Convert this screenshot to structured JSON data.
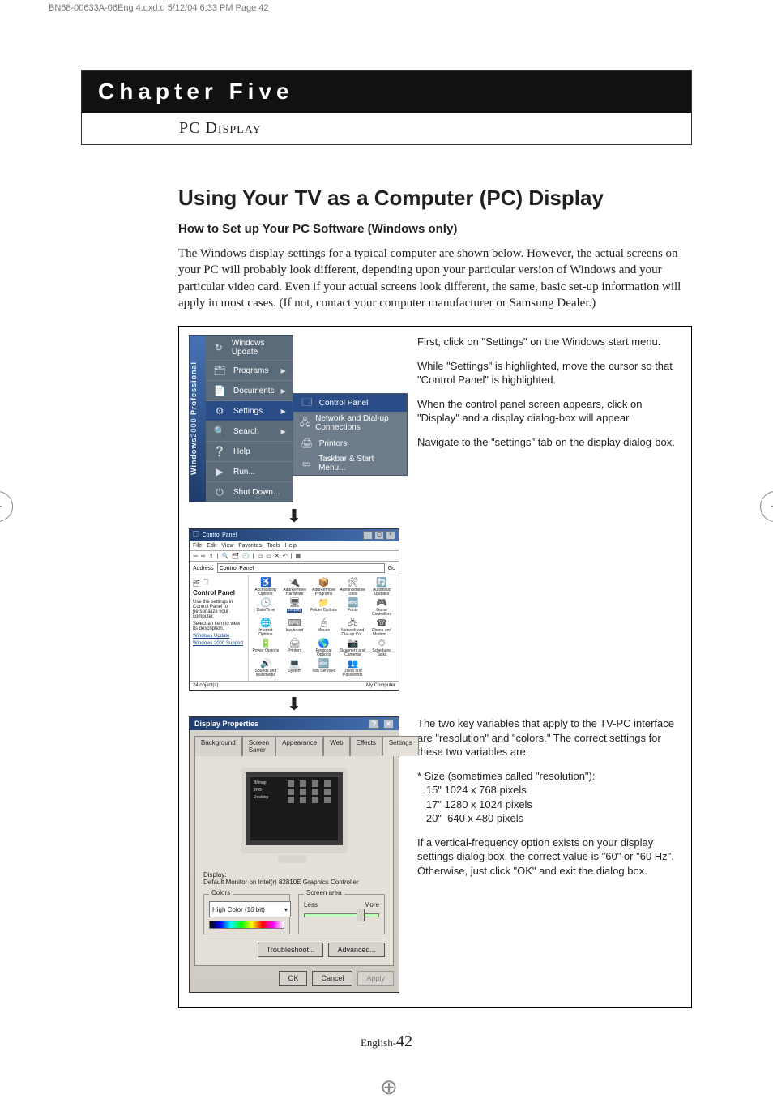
{
  "crop_header": "BN68-00633A-06Eng 4.qxd.q  5/12/04 6:33 PM  Page 42",
  "chapter": {
    "title": "Chapter Five",
    "subtitle": "PC Display"
  },
  "section": {
    "h1": "Using Your TV as a Computer (PC) Display",
    "h2": "How to Set up Your PC Software (Windows only)",
    "body": "The Windows display-settings for a typical computer are shown below. However, the actual screens on your PC will probably look different, depending upon your particular version of Windows and your particular video card. Even if your actual screens look different, the same, basic set-up information will apply in most cases. (If not, contact your computer manufacturer or Samsung Dealer.)"
  },
  "startmenu": {
    "side_label_a": "Windows",
    "side_label_b": "2000",
    "side_label_c": "Professional",
    "items": [
      {
        "label": "Windows Update",
        "icon": "↻"
      },
      {
        "label": "Programs",
        "icon": "🗂",
        "arrow": true
      },
      {
        "label": "Documents",
        "icon": "📄",
        "arrow": true
      },
      {
        "label": "Settings",
        "icon": "⚙",
        "arrow": true,
        "selected": true
      },
      {
        "label": "Search",
        "icon": "🔍",
        "arrow": true
      },
      {
        "label": "Help",
        "icon": "❔"
      },
      {
        "label": "Run...",
        "icon": "▶"
      },
      {
        "label": "Shut Down...",
        "icon": "⏻"
      }
    ],
    "submenu": [
      {
        "label": "Control Panel",
        "icon": "🗔",
        "selected": true
      },
      {
        "label": "Network and Dial-up Connections",
        "icon": "🖧"
      },
      {
        "label": "Printers",
        "icon": "🖨"
      },
      {
        "label": "Taskbar & Start Menu...",
        "icon": "▭"
      }
    ]
  },
  "instructions_top": {
    "p1": "First, click on \"Settings\" on the Windows start menu.",
    "p2": "While \"Settings\" is highlighted, move the cursor so that \"Control Panel\" is highlighted.",
    "p3": "When the control panel screen appears, click on \"Display\" and a display dialog-box will appear.",
    "p4": "Navigate to the \"settings\" tab on the display dialog-box."
  },
  "control_panel": {
    "title": "Control Panel",
    "menus": [
      "File",
      "Edit",
      "View",
      "Favorites",
      "Tools",
      "Help"
    ],
    "address_label": "Address",
    "address_value": "Control Panel",
    "go_label": "Go",
    "left_heading": "Control Panel",
    "left_desc": "Use the settings in Control Panel to personalize your computer.",
    "left_desc2": "Select an item to view its description.",
    "left_links": [
      "Windows Update",
      "Windows 2000 Support"
    ],
    "icons": [
      "Accessibility Options",
      "Add/Remove Hardware",
      "Add/Remove Programs",
      "Administrative Tools",
      "Automatic Updates",
      "Date/Time",
      "Display",
      "Folder Options",
      "Fonts",
      "Game Controllers",
      "Internet Options",
      "Keyboard",
      "Mouse",
      "Network and Dial-up Co...",
      "Phone and Modem ...",
      "Power Options",
      "Printers",
      "Regional Options",
      "Scanners and Cameras",
      "Scheduled Tasks",
      "Sounds and Multimedia",
      "System",
      "Text Services",
      "Users and Passwords",
      ""
    ],
    "selected": "Display",
    "status_left": "24 object(s)",
    "status_right": "My Computer"
  },
  "display_properties": {
    "title": "Display Properties",
    "tabs": [
      "Background",
      "Screen Saver",
      "Appearance",
      "Web",
      "Effects",
      "Settings"
    ],
    "active_tab": "Settings",
    "preview": {
      "labels": [
        "Bitmap",
        "JPG",
        "Desktop"
      ]
    },
    "display_label": "Display:",
    "display_value": "Default Monitor on Intel(r) 82810E Graphics Controller",
    "colors": {
      "label": "Colors",
      "value": "High Color (16 bit)"
    },
    "screen_area": {
      "label": "Screen area",
      "less": "Less",
      "more": "More"
    },
    "buttons": {
      "troubleshoot": "Troubleshoot...",
      "advanced": "Advanced...",
      "ok": "OK",
      "cancel": "Cancel",
      "apply": "Apply"
    }
  },
  "instructions_bottom": {
    "p1": "The two key variables that apply  to the TV-PC interface are \"resolution\" and \"colors.\" The correct settings for these two variables are:",
    "size_head": "* Size (sometimes called \"resolution\"):",
    "size_a": "   15\" 1024 x 768 pixels",
    "size_b": "   17\" 1280 x 1024 pixels",
    "size_c": "   20\"  640 x 480 pixels",
    "p2": "If a vertical-frequency option exists on your display settings dialog box, the correct value is \"60\" or \"60 Hz\". Otherwise, just click \"OK\" and exit the dialog box."
  },
  "footer": {
    "label": "English-",
    "page": "42"
  }
}
